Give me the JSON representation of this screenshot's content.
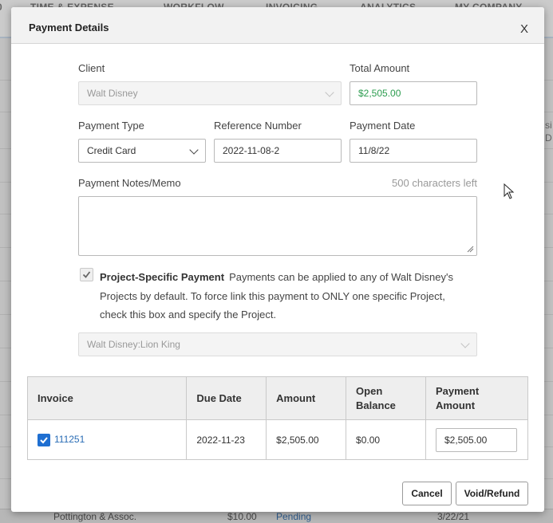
{
  "background": {
    "nav": [
      "TIME & EXPENSE",
      "WORKFLOW",
      "INVOICING",
      "ANALYTICS",
      "MY COMPANY"
    ],
    "side_text": [
      "si",
      "D"
    ],
    "bottom_row": {
      "client": "Pottington & Assoc.",
      "amount": "$10.00",
      "status": "Pending",
      "date": "3/22/21"
    }
  },
  "modal": {
    "title": "Payment Details",
    "close_label": "X",
    "client": {
      "label": "Client",
      "value": "Walt Disney"
    },
    "total_amount": {
      "label": "Total Amount",
      "value": "$2,505.00"
    },
    "payment_type": {
      "label": "Payment Type",
      "value": "Credit Card"
    },
    "reference_number": {
      "label": "Reference Number",
      "value": "2022-11-08-2"
    },
    "payment_date": {
      "label": "Payment Date",
      "value": "11/8/22"
    },
    "memo": {
      "label": "Payment Notes/Memo",
      "chars_left": "500 characters left",
      "value": ""
    },
    "project_specific": {
      "checked": true,
      "title": "Project-Specific Payment",
      "description": "Payments can be applied to any of Walt Disney's Projects by default. To force link this payment to ONLY one specific Project, check this box and specify the Project.",
      "project_value": "Walt Disney:Lion King"
    },
    "table": {
      "headers": [
        "Invoice",
        "Due Date",
        "Amount",
        "Open Balance",
        "Payment Amount"
      ],
      "rows": [
        {
          "checked": true,
          "invoice": "111251",
          "due_date": "2022-11-23",
          "amount": "$2,505.00",
          "open_balance": "$0.00",
          "payment_amount": "$2,505.00"
        }
      ]
    },
    "buttons": {
      "cancel": "Cancel",
      "void_refund": "Void/Refund"
    }
  },
  "colors": {
    "accent_blue": "#1f6fd1",
    "link_blue": "#2a6db5",
    "amount_green": "#2b9c4e"
  },
  "icons": [
    "chevron-down-icon",
    "check-icon",
    "close-icon",
    "resize-grip-icon",
    "mouse-cursor-icon"
  ]
}
